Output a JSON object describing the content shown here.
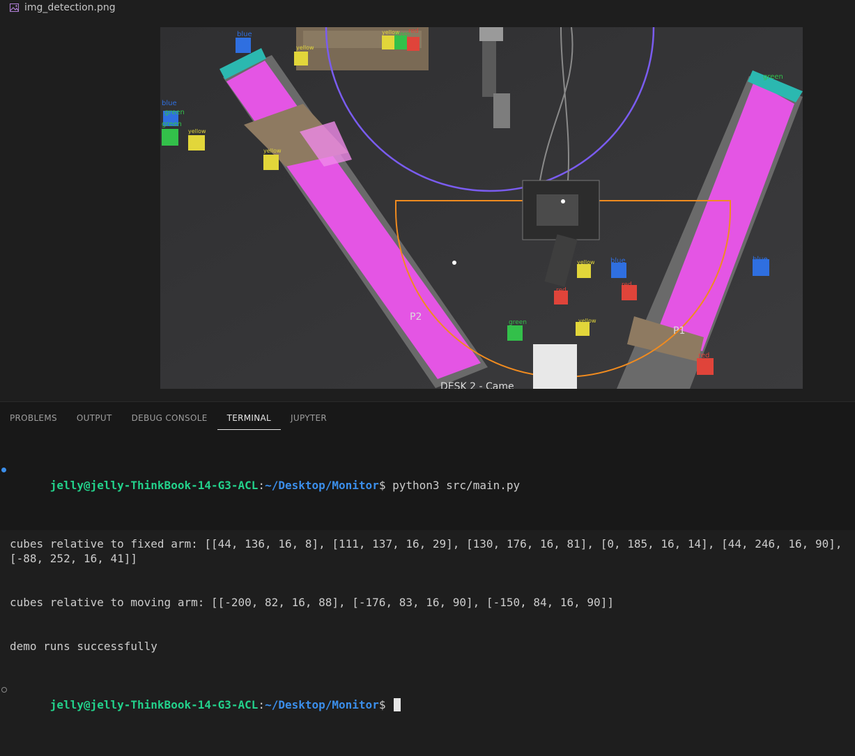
{
  "tab": {
    "title": "img_detection.png",
    "icon": "image-file-icon"
  },
  "image": {
    "labels": {
      "p1": "P1",
      "p2": "P2",
      "camera_text": "DESK 2 - Came",
      "cubes": [
        {
          "label": "blue",
          "color": "#2f6fe0"
        },
        {
          "label": "green",
          "color": "#33c04a"
        },
        {
          "label": "yellow",
          "color": "#e2d63a"
        },
        {
          "label": "red",
          "color": "#e0443a"
        }
      ]
    }
  },
  "panel": {
    "tabs": [
      "PROBLEMS",
      "OUTPUT",
      "DEBUG CONSOLE",
      "TERMINAL",
      "JUPYTER"
    ],
    "active_tab": "TERMINAL"
  },
  "terminal": {
    "prompt_user": "jelly@jelly-ThinkBook-14-G3-ACL",
    "prompt_sep": ":",
    "prompt_path": "~/Desktop/Monitor",
    "prompt_end": "$ ",
    "command": "python3 src/main.py",
    "output_lines": [
      "cubes relative to fixed arm: [[44, 136, 16, 8], [111, 137, 16, 29], [130, 176, 16, 81], [0, 185, 16, 14], [44, 246, 16, 90], [-88, 252, 16, 41]]",
      "cubes relative to moving arm: [[-200, 82, 16, 88], [-176, 83, 16, 90], [-150, 84, 16, 90]]",
      "demo runs successfully"
    ]
  }
}
